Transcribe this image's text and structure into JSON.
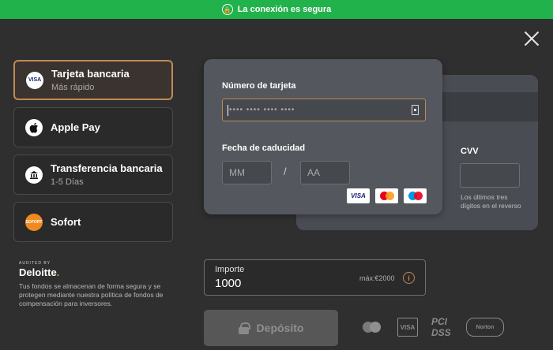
{
  "topbar": {
    "secure_text": "La conexión es segura",
    "icon": "shield-lock-icon",
    "color": "#22b24c"
  },
  "close": {
    "icon": "close-icon"
  },
  "methods": [
    {
      "title": "Tarjeta bancaria",
      "subtitle": "Más rápido",
      "icon": "visa-icon",
      "active": true
    },
    {
      "title": "Apple Pay",
      "subtitle": "",
      "icon": "apple-icon",
      "active": false
    },
    {
      "title": "Transferencia bancaria",
      "subtitle": "1-5 Días",
      "icon": "bank-icon",
      "active": false
    },
    {
      "title": "Sofort",
      "subtitle": "",
      "icon": "sofort-icon",
      "active": false
    }
  ],
  "audit": {
    "small": "AUDITED BY",
    "brand": "Deloitte"
  },
  "funds_text": "Tus fondos se almacenan de forma segura y se protegen mediante nuestra política de fondos de compensación para inversores.",
  "card": {
    "number_label": "Número de tarjeta",
    "number_placeholder": "•••• •••• •••• ••••",
    "expiry_label": "Fecha de caducidad",
    "month_placeholder": "MM",
    "year_placeholder": "AA",
    "separator": "/",
    "cvv_label": "CVV",
    "cvv_help": "Los últimos tres dígitos en el reverso",
    "logos": [
      "VISA",
      "mastercard",
      "maestro"
    ]
  },
  "amount": {
    "label": "Importe",
    "value": "1000",
    "max": "máx:€2000"
  },
  "deposit": {
    "label": "Depósito",
    "enabled": false
  },
  "trust_badges": [
    "mastercard-badge",
    "VISA",
    "PCI DSS",
    "Norton"
  ],
  "colors": {
    "accent": "#c08a55",
    "background": "#2f2f2f"
  }
}
